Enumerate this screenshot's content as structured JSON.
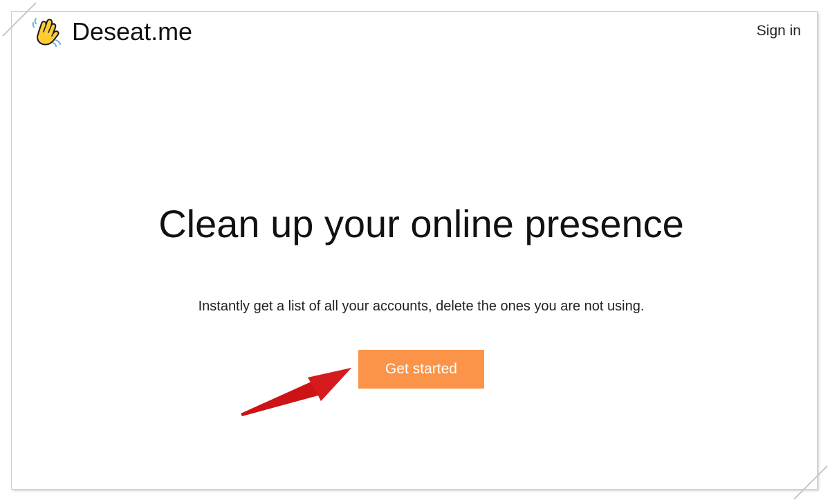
{
  "header": {
    "logo_icon": "waving-hand-icon",
    "brand_name": "Deseat.me",
    "sign_in_label": "Sign in"
  },
  "hero": {
    "title": "Clean up your online presence",
    "subtitle": "Instantly get a list of all your accounts, delete the ones you are not using.",
    "cta_label": "Get started"
  },
  "colors": {
    "accent": "#fb9448",
    "annotation_arrow": "#cc1416",
    "text": "#111111"
  },
  "annotation": {
    "icon": "red-arrow-icon"
  }
}
